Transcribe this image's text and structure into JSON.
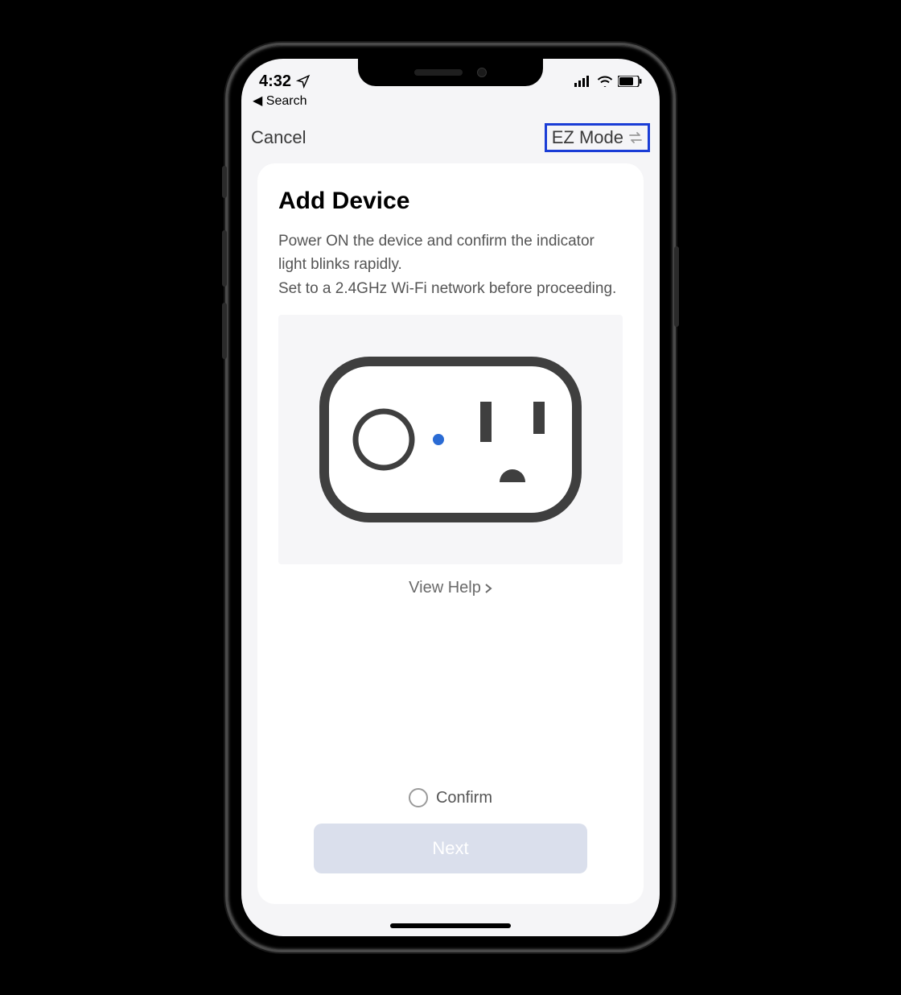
{
  "statusbar": {
    "time": "4:32",
    "back_label": "Search"
  },
  "nav": {
    "cancel": "Cancel",
    "mode": "EZ Mode"
  },
  "card": {
    "title": "Add Device",
    "desc_line1": "Power ON the device and confirm the indicator light blinks rapidly.",
    "desc_line2": "Set to a 2.4GHz Wi-Fi network before proceeding.",
    "help": "View Help",
    "confirm": "Confirm",
    "next": "Next"
  }
}
